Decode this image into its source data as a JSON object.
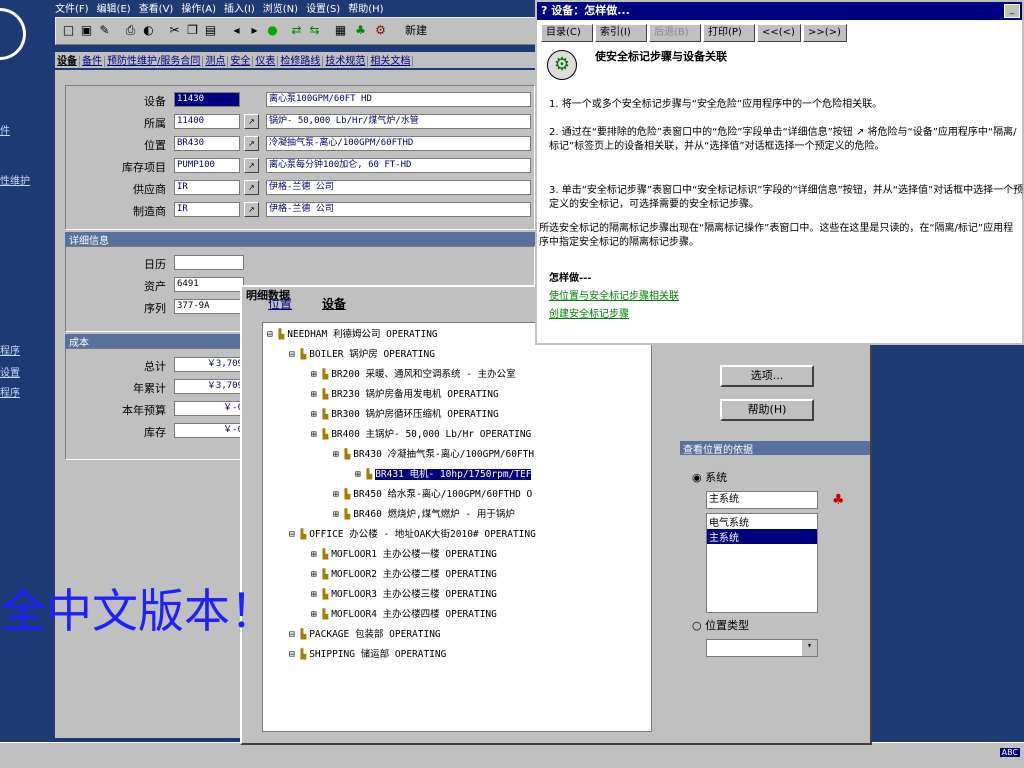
{
  "menu": [
    "文件(F)",
    "编辑(E)",
    "查看(V)",
    "操作(A)",
    "插入(I)",
    "浏览(N)",
    "设置(S)",
    "帮助(H)"
  ],
  "toolbar": {
    "new_label": "新建"
  },
  "tabs": [
    "设备",
    "备件",
    "预防性维护/服务合同",
    "测点",
    "安全",
    "仪表",
    "检修路线",
    "技术规范",
    "相关文档"
  ],
  "sidebar": [
    "件",
    "性维护",
    "程序",
    "设置",
    "程序"
  ],
  "equipment": {
    "rows": [
      {
        "label": "设备",
        "code": "11430",
        "desc": "离心泵100GPM/60FT HD"
      },
      {
        "label": "所属",
        "code": "11400",
        "desc": "锅炉- 50,000 Lb/Hr/煤气炉/水管"
      },
      {
        "label": "位置",
        "code": "BR430",
        "desc": "冷凝抽气泵-离心/100GPM/60FTHD"
      },
      {
        "label": "库存项目",
        "code": "PUMP100",
        "desc": "离心泵每分钟100加仑, 60 FT-HD"
      },
      {
        "label": "供应商",
        "code": "IR",
        "desc": "伊格-兰德 公司"
      },
      {
        "label": "制造商",
        "code": "IR",
        "desc": "伊格-兰德 公司"
      }
    ],
    "details_header": "详细信息",
    "details": [
      {
        "label": "日历",
        "value": ""
      },
      {
        "label": "资产",
        "value": "6491"
      },
      {
        "label": "序列",
        "value": "377-9A"
      }
    ],
    "cost_header": "成本",
    "costs": [
      {
        "label": "总计",
        "value": "￥3,709"
      },
      {
        "label": "年累计",
        "value": "￥3,709"
      },
      {
        "label": "本年预算",
        "value": "￥-0"
      },
      {
        "label": "库存",
        "value": "￥-0"
      }
    ]
  },
  "help": {
    "title": "设备：怎样做...",
    "buttons": [
      "目录(C)",
      "索引(I)",
      "后退(B)",
      "打印(P)",
      "<<(<)",
      ">>(>)"
    ],
    "heading": "使安全标记步骤与设备关联",
    "steps": [
      "1. 将一个或多个安全标记步骤与“安全危险”应用程序中的一个危险相关联。",
      "2. 通过在“要排除的危险”表窗口中的“危险”字段单击“详细信息”按钮 ↗ 将危险与“设备”应用程序中“隔离/标记”标签页上的设备相关联，并从“选择值”对话框选择一个预定义的危险。",
      "3. 单击“安全标记步骤”表窗口中“安全标记标识”字段的“详细信息”按钮，并从“选择值”对话框中选择一个预定义的安全标记，可选择需要的安全标记步骤。"
    ],
    "note": "所选安全标记的隔离标记步骤出现在“隔离标记操作”表窗口中。这些在这里是只读的，在“隔离/标记”应用程序中指定安全标记的隔离标记步骤。",
    "howto": "怎样做---",
    "links": [
      "使位置与安全标记步骤相关联",
      "创建安全标记步骤"
    ]
  },
  "detail": {
    "title": "明细数据",
    "tabs": [
      "位置",
      "设备"
    ],
    "tree": [
      {
        "text": "NEEDHAM   利德姆公司  OPERATING",
        "indent": 0
      },
      {
        "text": "BOILER   锅炉房  OPERATING",
        "indent": 1
      },
      {
        "text": "BR200   采暖、通风和空调系统 - 主办公室",
        "indent": 2
      },
      {
        "text": "BR230   锅炉房备用发电机  OPERATING",
        "indent": 2
      },
      {
        "text": "BR300   锅炉房循环压缩机  OPERATING",
        "indent": 2
      },
      {
        "text": "BR400   主锅炉- 50,000 Lb/Hr  OPERATING",
        "indent": 2
      },
      {
        "text": "BR430   冷凝抽气泵-离心/100GPM/60FTH",
        "indent": 3
      },
      {
        "text": "BR431   电机- 10hp/1750rpm/TEF",
        "indent": 4,
        "selected": true
      },
      {
        "text": "BR450   给水泵-离心/100GPM/60FTHD  O",
        "indent": 3
      },
      {
        "text": "BR460   燃烧炉,煤气燃炉 - 用于锅炉",
        "indent": 3
      },
      {
        "text": "OFFICE   办公楼 - 地址OAK大街2010#  OPERATING",
        "indent": 1
      },
      {
        "text": "MOFLOOR1   主办公楼一楼  OPERATING",
        "indent": 2
      },
      {
        "text": "MOFLOOR2   主办公楼二楼  OPERATING",
        "indent": 2
      },
      {
        "text": "MOFLOOR3   主办公楼三楼  OPERATING",
        "indent": 2
      },
      {
        "text": "MOFLOOR4   主办公楼四楼  OPERATING",
        "indent": 2
      },
      {
        "text": "PACKAGE   包装部  OPERATING",
        "indent": 1
      },
      {
        "text": "SHIPPING   储运部  OPERATING",
        "indent": 1
      }
    ],
    "options_button": "选项...",
    "help_button": "帮助(H)",
    "basis_header": "查看位置的依据",
    "system_radio": "系统",
    "system_value": "主系统",
    "system_list": [
      "电气系统",
      "主系统"
    ],
    "loctype_radio": "位置类型"
  },
  "overlay_text": "全中文版本！",
  "status": {
    "ime": "ABC"
  }
}
